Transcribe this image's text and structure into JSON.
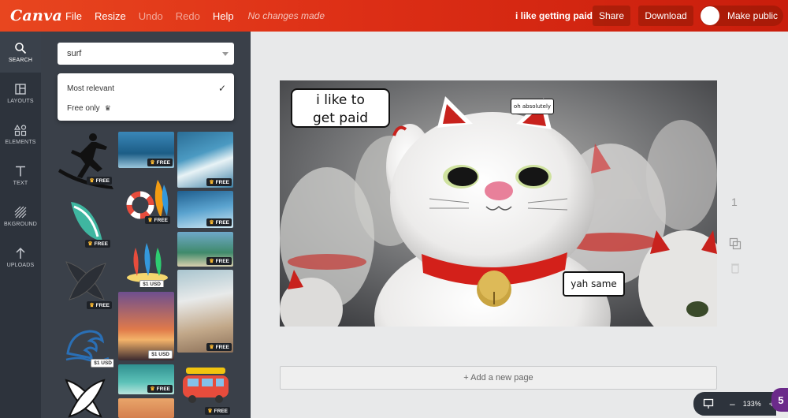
{
  "app": {
    "logo": "Canva"
  },
  "menu": {
    "file": "File",
    "resize": "Resize",
    "undo": "Undo",
    "redo": "Redo",
    "help": "Help",
    "status": "No changes made"
  },
  "header": {
    "doc_title": "i like getting paid",
    "share": "Share",
    "download": "Download",
    "make_public": "Make public"
  },
  "rail": [
    {
      "label": "SEARCH",
      "icon": "search-icon"
    },
    {
      "label": "LAYOUTS",
      "icon": "layouts-icon"
    },
    {
      "label": "ELEMENTS",
      "icon": "shapes-icon"
    },
    {
      "label": "TEXT",
      "icon": "text-icon"
    },
    {
      "label": "BKGROUND",
      "icon": "background-pattern-icon"
    },
    {
      "label": "UPLOADS",
      "icon": "upload-arrow-icon"
    }
  ],
  "search": {
    "value": "surf"
  },
  "dropdown": {
    "most_relevant": "Most relevant",
    "free_only": "Free only"
  },
  "badges": {
    "free": "FREE",
    "one_usd": "$1 USD"
  },
  "bubbles": {
    "main_line1": "i like to",
    "main_line2": "get paid",
    "small": "oh absolutely",
    "bottom": "yah same"
  },
  "canvas": {
    "add_page": "+ Add a new page",
    "page_number": "1"
  },
  "zoom": {
    "level": "133%",
    "minus": "–",
    "plus": "+"
  },
  "help": {
    "count": "5"
  },
  "colors": {
    "accent": "#dd2f16",
    "rail": "#2d333c",
    "panel": "#3a4049"
  }
}
